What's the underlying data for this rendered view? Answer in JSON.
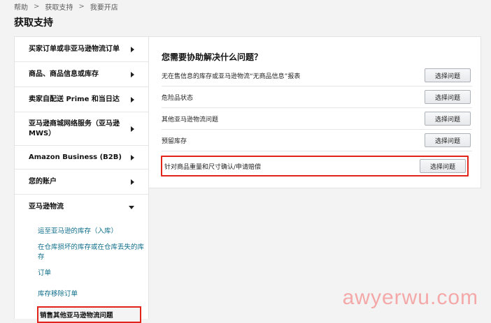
{
  "breadcrumb": [
    "帮助",
    "获取支持",
    "我要开店"
  ],
  "breadcrumb_sep": ">",
  "page_title": "获取支持",
  "sidebar": {
    "items": [
      {
        "label": "买家订单或非亚马逊物流订单"
      },
      {
        "label": "商品、商品信息或库存"
      },
      {
        "label": "卖家自配送 Prime 和当日达"
      },
      {
        "label": "亚马逊商城网络服务（亚马逊 MWS）"
      },
      {
        "label": "Amazon Business (B2B)"
      },
      {
        "label": "您的账户"
      },
      {
        "label": "亚马逊物流"
      }
    ],
    "sub_items": [
      {
        "label": "运至亚马逊的库存（入库）"
      },
      {
        "label": "在仓库损坏的库存或在仓库丢失的库存"
      },
      {
        "label": "订单"
      },
      {
        "label": "库存移除订单"
      },
      {
        "label": "销售其他亚马逊物流问题"
      }
    ]
  },
  "panel": {
    "title": "您需要协助解决什么问题？",
    "questions": [
      {
        "label": "无在售信息的库存或亚马逊物流“无商品信息”报表",
        "button": "选择问题"
      },
      {
        "label": "危险品状态",
        "button": "选择问题"
      },
      {
        "label": "其他亚马逊物流问题",
        "button": "选择问题"
      },
      {
        "label": "预留库存",
        "button": "选择问题"
      },
      {
        "label": "针对商品重量和尺寸确认/申请赔偿",
        "button": "选择问题"
      }
    ]
  },
  "watermark": "awyerwu.com",
  "colors": {
    "highlight": "#e2231a",
    "link": "#0d6d8a"
  }
}
